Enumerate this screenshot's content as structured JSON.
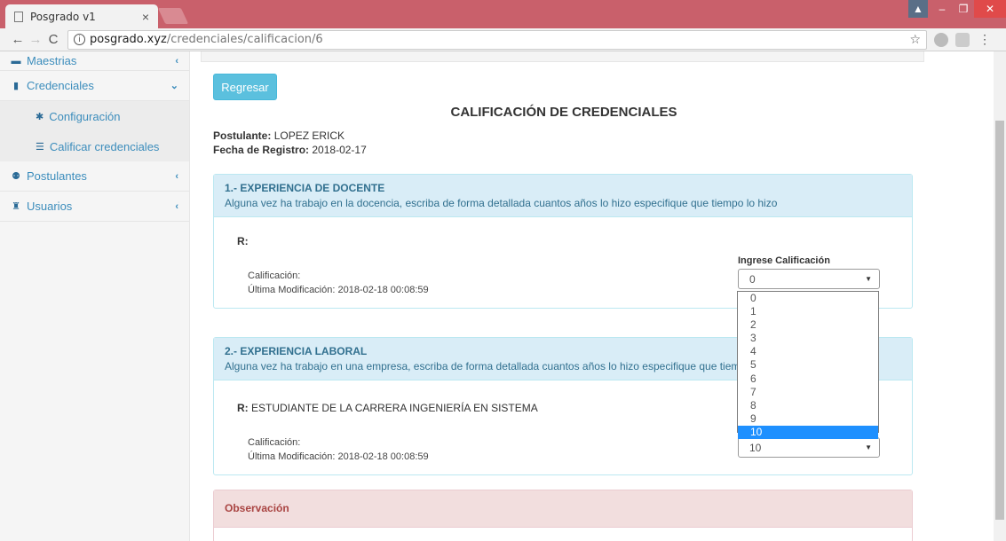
{
  "browser": {
    "tab_title": "Posgrado v1",
    "tab_close": "×",
    "url_host": "posgrado.xyz",
    "url_path": "/credenciales/calificacion/6"
  },
  "sidebar": {
    "items": [
      {
        "label": "Maestrias",
        "icon": "book-icon",
        "chevron": "‹"
      },
      {
        "label": "Credenciales",
        "icon": "clipboard-icon",
        "chevron": "⌄"
      },
      {
        "label": "Postulantes",
        "icon": "users-icon",
        "chevron": "‹"
      },
      {
        "label": "Usuarios",
        "icon": "user-icon",
        "chevron": "‹"
      }
    ],
    "subitems": [
      {
        "label": "Configuración",
        "icon": "gear-icon"
      },
      {
        "label": "Calificar credenciales",
        "icon": "list-icon"
      }
    ]
  },
  "main": {
    "back_button": "Regresar",
    "title": "CALIFICACIÓN DE CREDENCIALES",
    "applicant_label": "Postulante:",
    "applicant_value": "LOPEZ ERICK",
    "date_label": "Fecha de Registro:",
    "date_value": "2018-02-17",
    "panels": [
      {
        "title": "1.- EXPERIENCIA DE DOCENTE",
        "description": "Alguna vez ha trabajo en la docencia, escriba de forma detallada cuantos años lo hizo especifique que tiempo lo hizo",
        "answer_label": "R:",
        "answer_value": "",
        "score_label": "Calificación:",
        "modified": "Última Modificación: 2018-02-18 00:08:59",
        "select_label": "Ingrese Calificación",
        "select_value": "0"
      },
      {
        "title": "2.- EXPERIENCIA LABORAL",
        "description": "Alguna vez ha trabajo en una empresa, escriba de forma detallada cuantos años lo hizo especifique que tiempo",
        "answer_label": "R:",
        "answer_value": "ESTUDIANTE DE LA CARRERA INGENIERÍA EN SISTEMA",
        "score_label": "Calificación:",
        "modified": "Última Modificación: 2018-02-18 00:08:59",
        "select_value": "10"
      }
    ],
    "observation_title": "Observación",
    "dropdown_options": [
      "0",
      "1",
      "2",
      "3",
      "4",
      "5",
      "6",
      "7",
      "8",
      "9",
      "10"
    ],
    "dropdown_selected": "10"
  },
  "colors": {
    "accent": "#3c8dbc",
    "info_header": "#d9edf7",
    "danger_header": "#f2dede",
    "button": "#5bc0de",
    "titlebar": "#c9606b"
  }
}
